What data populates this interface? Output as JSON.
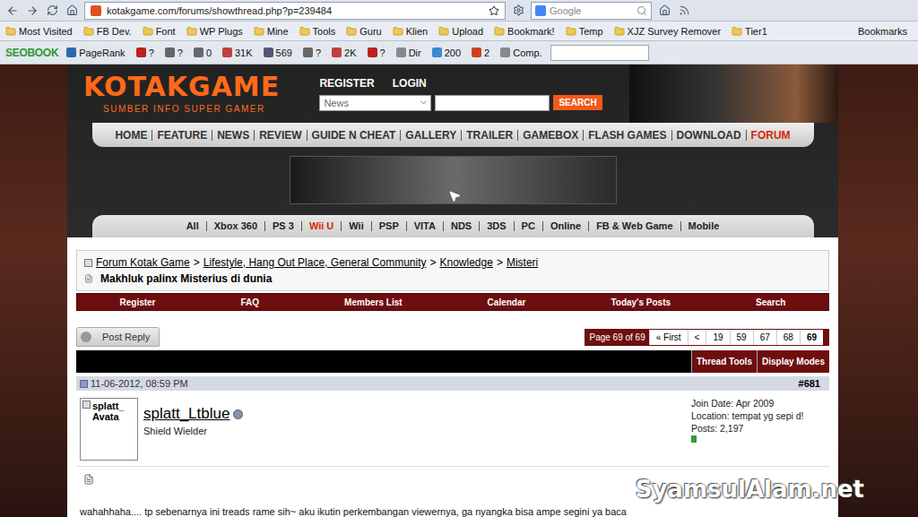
{
  "browser": {
    "url": "kotakgame.com/forums/showthread.php?p=239484",
    "search_placeholder": "Google",
    "bookmarks": [
      "Most Visited",
      "FB Dev.",
      "Font",
      "WP Plugs",
      "Mine",
      "Tools",
      "Guru",
      "Klien",
      "Upload",
      "Bookmark!",
      "Temp",
      "XJZ Survey Remover",
      "Tier1"
    ],
    "bookmarks_menu": "Bookmarks",
    "seo_logo": "SEOBOOK",
    "seo_items": [
      "PageRank",
      "?",
      "?",
      "0",
      "31K",
      "569",
      "?",
      "2K",
      "?",
      "Dir",
      "200",
      "2",
      "Comp."
    ]
  },
  "site": {
    "logo": "KOTAKGAME",
    "tagline": "SUMBER INFO SUPER GAMER",
    "register": "REGISTER",
    "login": "LOGIN",
    "search_select": "News",
    "search_button": "SEARCH"
  },
  "main_nav": [
    {
      "label": "HOME",
      "selected": false
    },
    {
      "label": "FEATURE",
      "selected": false
    },
    {
      "label": "NEWS",
      "selected": false
    },
    {
      "label": "REVIEW",
      "selected": false
    },
    {
      "label": "GUIDE N CHEAT",
      "selected": false
    },
    {
      "label": "GALLERY",
      "selected": false
    },
    {
      "label": "TRAILER",
      "selected": false
    },
    {
      "label": "GAMEBOX",
      "selected": false
    },
    {
      "label": "FLASH GAMES",
      "selected": false
    },
    {
      "label": "DOWNLOAD",
      "selected": false
    },
    {
      "label": "FORUM",
      "selected": true
    }
  ],
  "platform_nav": [
    {
      "label": "All",
      "selected": false
    },
    {
      "label": "Xbox 360",
      "selected": false
    },
    {
      "label": "PS 3",
      "selected": false
    },
    {
      "label": "Wii U",
      "selected": true
    },
    {
      "label": "Wii",
      "selected": false
    },
    {
      "label": "PSP",
      "selected": false
    },
    {
      "label": "VITA",
      "selected": false
    },
    {
      "label": "NDS",
      "selected": false
    },
    {
      "label": "3DS",
      "selected": false
    },
    {
      "label": "PC",
      "selected": false
    },
    {
      "label": "Online",
      "selected": false
    },
    {
      "label": "FB & Web Game",
      "selected": false
    },
    {
      "label": "Mobile",
      "selected": false
    }
  ],
  "breadcrumb": [
    "Forum Kotak Game",
    "Lifestyle, Hang Out Place, General Community",
    "Knowledge",
    "Misteri"
  ],
  "breadcrumb_separator": ">",
  "thread_title": "Makhluk palinx Misterius di dunia",
  "forum_bar": [
    "Register",
    "FAQ",
    "Members List",
    "Calendar",
    "Today's Posts",
    "Search"
  ],
  "post_reply": "Post Reply",
  "pagination": {
    "summary": "Page 69 of 69",
    "pages": [
      {
        "label": "« First",
        "selected": false
      },
      {
        "label": "<",
        "selected": false
      },
      {
        "label": "19",
        "selected": false
      },
      {
        "label": "59",
        "selected": false
      },
      {
        "label": "67",
        "selected": false
      },
      {
        "label": "68",
        "selected": false
      },
      {
        "label": "69",
        "selected": true
      }
    ]
  },
  "thread_tools": [
    "Thread Tools",
    "Display Modes"
  ],
  "post": {
    "date": "11-06-2012, 08:59 PM",
    "number": "#681",
    "avatar_text": [
      "splatt_",
      "Avata"
    ],
    "username": "splatt_Ltblue",
    "online": false,
    "user_title": "Shield Wielder",
    "info": [
      {
        "label": "Join Date:",
        "value": "Apr 2009"
      },
      {
        "label": "Location:",
        "value": "tempat yg sepi d!"
      },
      {
        "label": "Posts:",
        "value": "2,197"
      }
    ],
    "reputation": 1,
    "body": "wahahhaha.... tp sebenarnya ini treads rame sih~ aku ikutin perkembangan viewernya, ga nyangka bisa ampe segini ya baca"
  },
  "watermark": "SyamsulAlam.net"
}
